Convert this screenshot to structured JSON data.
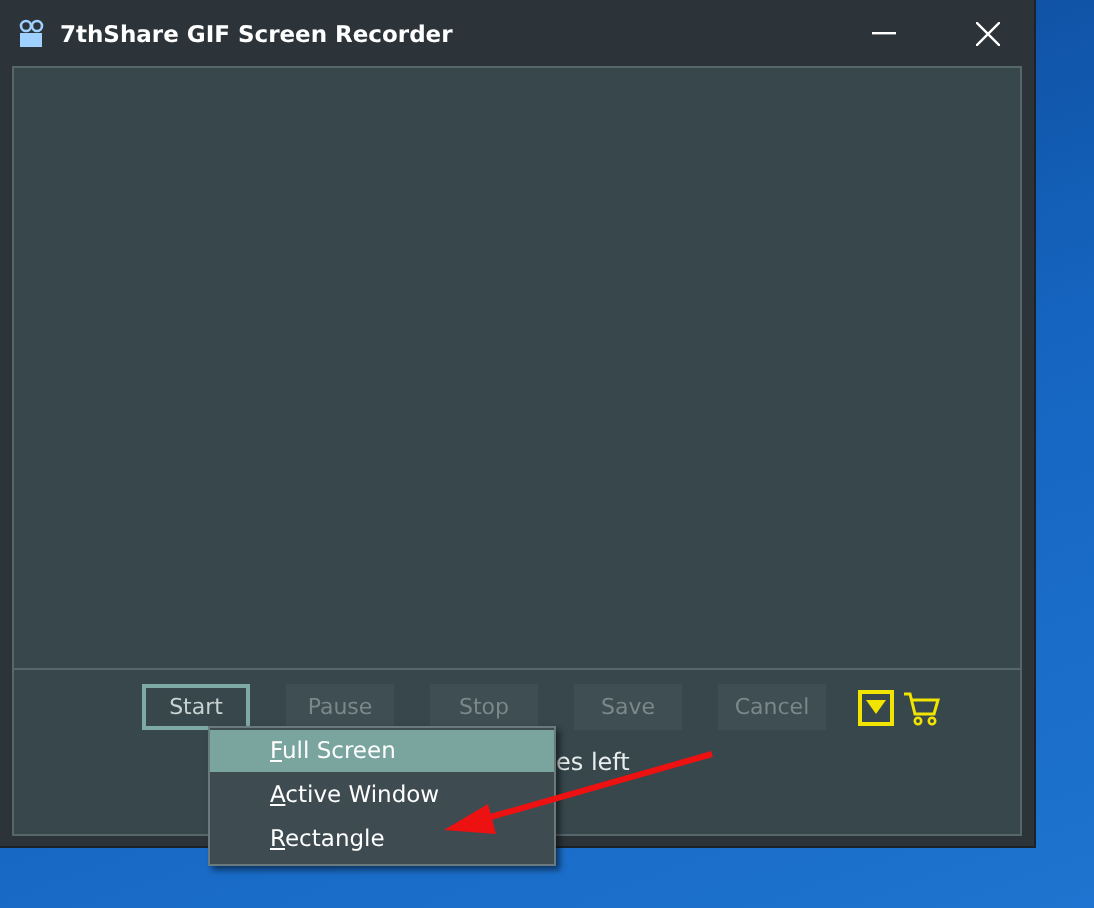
{
  "window": {
    "title": "7thShare GIF Screen Recorder"
  },
  "toolbar": {
    "buttons": [
      {
        "label": "Start",
        "disabled": false
      },
      {
        "label": "Pause",
        "disabled": true
      },
      {
        "label": "Stop",
        "disabled": true
      },
      {
        "label": "Save",
        "disabled": true
      },
      {
        "label": "Cancel",
        "disabled": true
      }
    ]
  },
  "status": {
    "text": "es left"
  },
  "menu": {
    "items": [
      {
        "label": "Full Screen",
        "selected": true
      },
      {
        "label": "Active Window",
        "selected": false
      },
      {
        "label": "Rectangle",
        "selected": false
      }
    ]
  }
}
